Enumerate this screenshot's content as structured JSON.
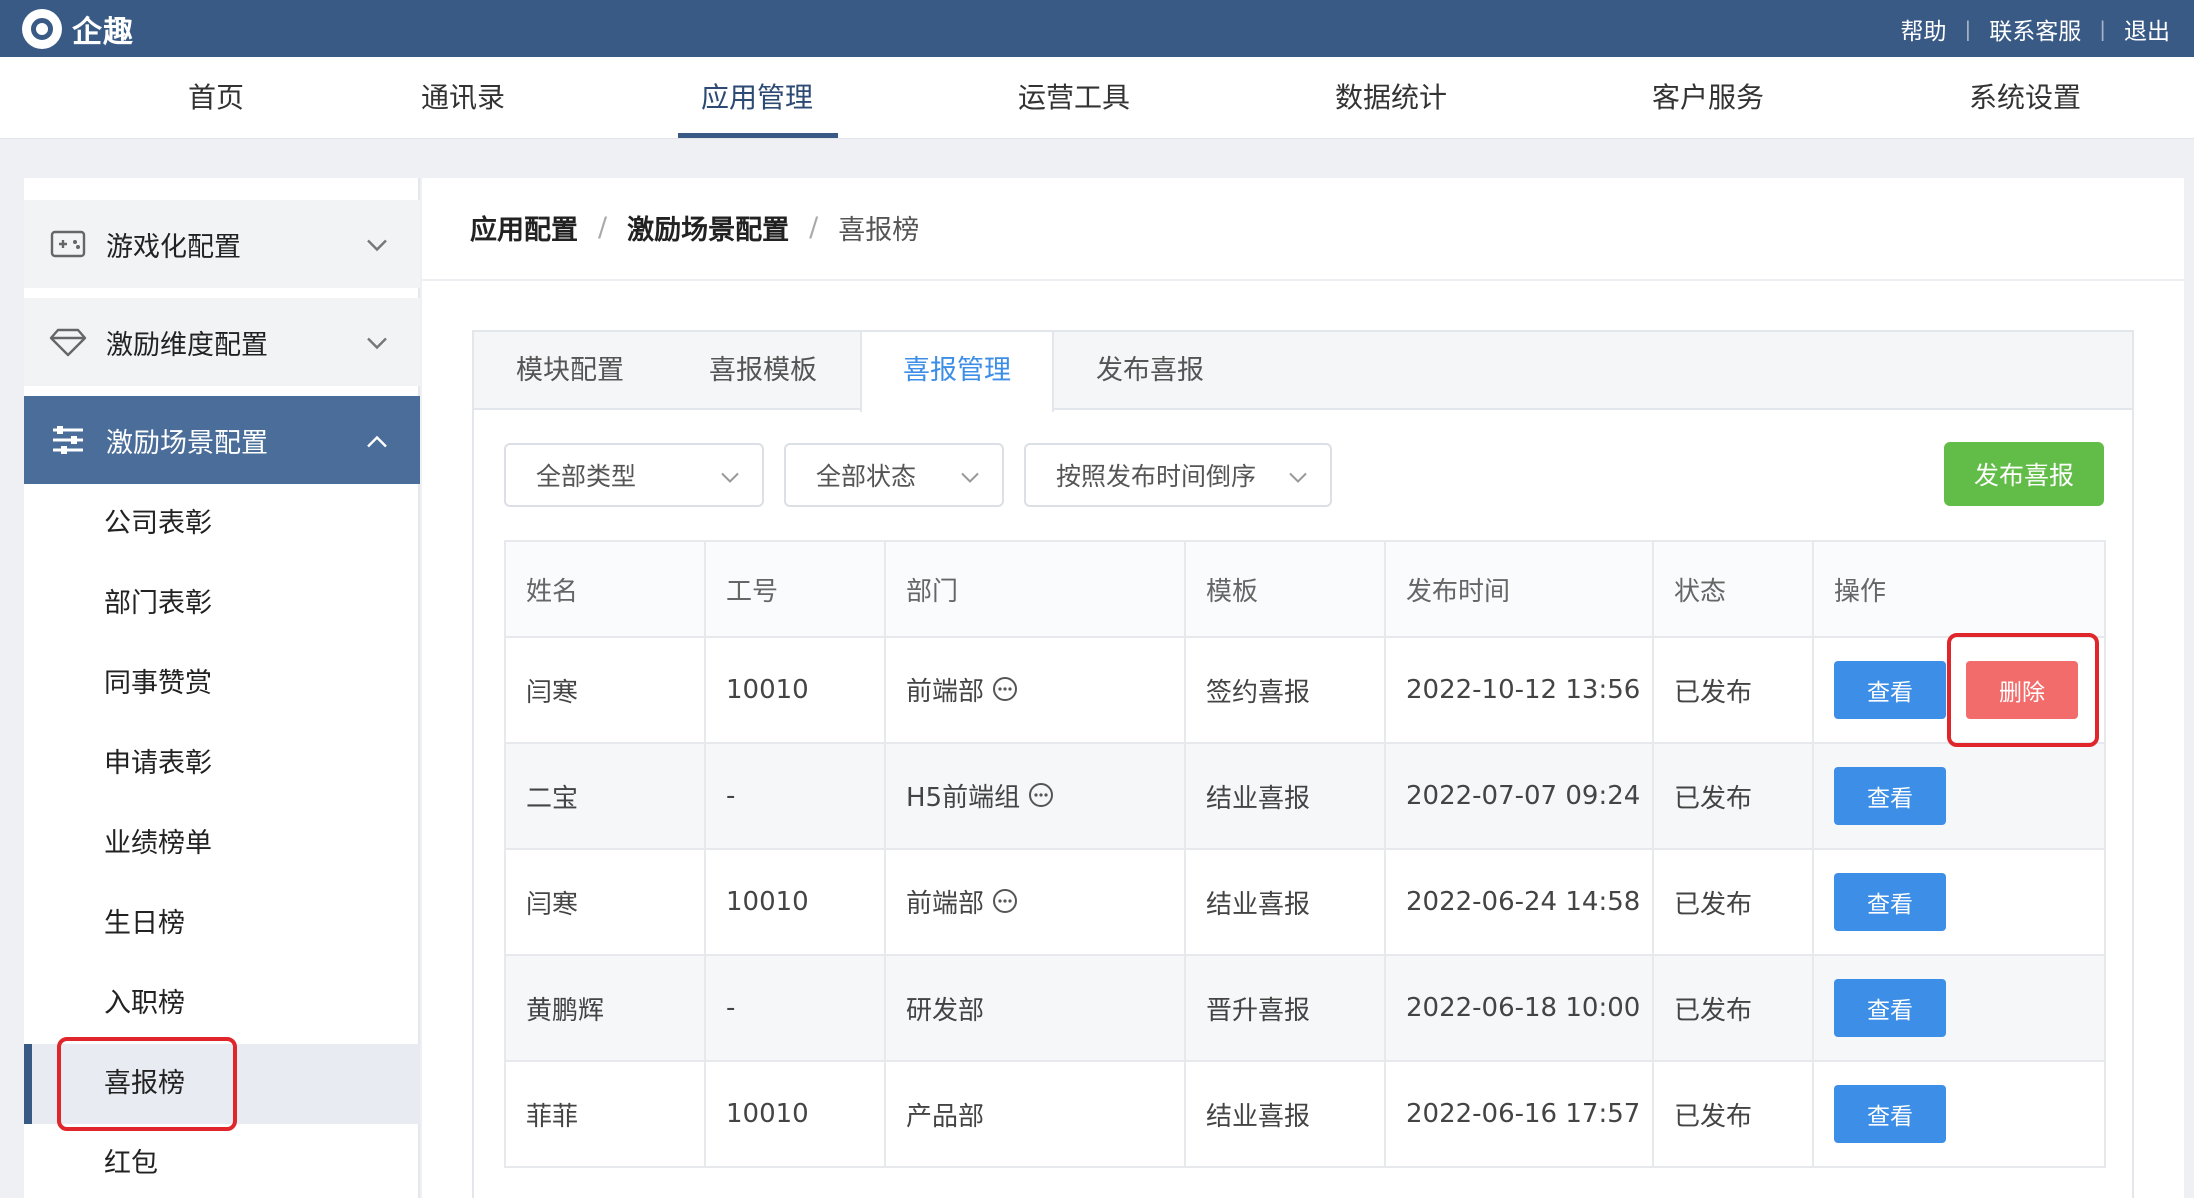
{
  "brand": {
    "name": "企趣"
  },
  "top_links": {
    "help": "帮助",
    "support": "联系客服",
    "logout": "退出"
  },
  "nav": {
    "items": [
      "首页",
      "通讯录",
      "应用管理",
      "运营工具",
      "数据统计",
      "客户服务",
      "系统设置"
    ],
    "active": "应用管理"
  },
  "sidebar": {
    "groups": [
      {
        "label": "游戏化配置",
        "icon": "gamepad-icon",
        "expanded": false
      },
      {
        "label": "激励维度配置",
        "icon": "diamond-icon",
        "expanded": false
      },
      {
        "label": "激励场景配置",
        "icon": "sliders-icon",
        "expanded": true
      }
    ],
    "sub_items": [
      "公司表彰",
      "部门表彰",
      "同事赞赏",
      "申请表彰",
      "业绩榜单",
      "生日榜",
      "入职榜",
      "喜报榜",
      "红包"
    ],
    "active_sub": "喜报榜"
  },
  "breadcrumb": {
    "items": [
      "应用配置",
      "激励场景配置",
      "喜报榜"
    ]
  },
  "tabs": {
    "items": [
      "模块配置",
      "喜报模板",
      "喜报管理",
      "发布喜报"
    ],
    "active": "喜报管理"
  },
  "filters": {
    "type": "全部类型",
    "status": "全部状态",
    "sort": "按照发布时间倒序"
  },
  "publish_button": "发布喜报",
  "table": {
    "headers": [
      "姓名",
      "工号",
      "部门",
      "模板",
      "发布时间",
      "状态",
      "操作"
    ],
    "view_label": "查看",
    "delete_label": "删除",
    "rows": [
      {
        "name": "闫寒",
        "id": "10010",
        "dept": "前端部",
        "dept_icon": true,
        "template": "签约喜报",
        "time": "2022-10-12 13:56",
        "status": "已发布"
      },
      {
        "name": "二宝",
        "id": "-",
        "dept": "H5前端组",
        "dept_icon": true,
        "template": "结业喜报",
        "time": "2022-07-07 09:24",
        "status": "已发布"
      },
      {
        "name": "闫寒",
        "id": "10010",
        "dept": "前端部",
        "dept_icon": true,
        "template": "结业喜报",
        "time": "2022-06-24 14:58",
        "status": "已发布"
      },
      {
        "name": "黄鹏辉",
        "id": "-",
        "dept": "研发部",
        "dept_icon": false,
        "template": "晋升喜报",
        "time": "2022-06-18 10:00",
        "status": "已发布"
      },
      {
        "name": "菲菲",
        "id": "10010",
        "dept": "产品部",
        "dept_icon": false,
        "template": "结业喜报",
        "time": "2022-06-16 17:57",
        "status": "已发布"
      }
    ]
  },
  "colors": {
    "header": "#3a5a86",
    "accent_blue": "#3d8ee6",
    "success_green": "#55b83e",
    "publish_green": "#62bd48",
    "danger_red": "#f26c6c",
    "highlight_red": "#e0262b"
  }
}
